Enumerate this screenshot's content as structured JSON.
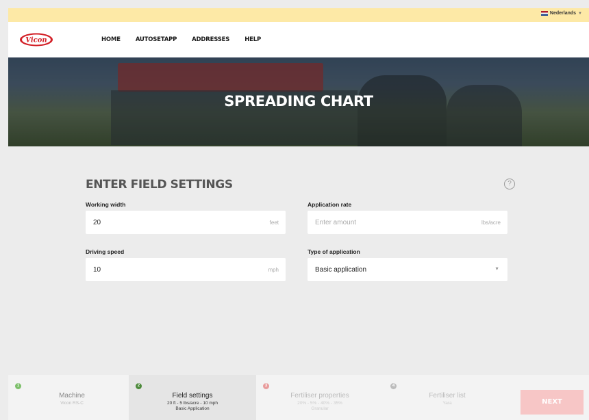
{
  "language": {
    "label": "Nederlands",
    "flag_icon": "netherlands-flag-icon"
  },
  "logo": {
    "text": "Vicon",
    "color": "#d32027"
  },
  "nav": {
    "items": [
      "HOME",
      "AUTOSETAPP",
      "ADDRESSES",
      "HELP"
    ]
  },
  "hero": {
    "title": "SPREADING CHART"
  },
  "form": {
    "title": "ENTER FIELD SETTINGS",
    "help_icon": "?",
    "working_width": {
      "label": "Working width",
      "value": "20",
      "unit": "feet"
    },
    "application_rate": {
      "label": "Application rate",
      "placeholder": "Enter amount",
      "unit": "lbs/acre"
    },
    "driving_speed": {
      "label": "Driving speed",
      "value": "10",
      "unit": "mph"
    },
    "application_type": {
      "label": "Type of application",
      "value": "Basic application"
    }
  },
  "steps": [
    {
      "number": "1",
      "name": "Machine",
      "sub": [
        "Vicon RS-C"
      ],
      "color": "#7cbf6a"
    },
    {
      "number": "2",
      "name": "Field settings",
      "sub": [
        "20 ft - 5 lbs/acre - 10 mph",
        "Basic Application"
      ],
      "color": "#4c8a3a"
    },
    {
      "number": "3",
      "name": "Fertiliser properties",
      "sub": [
        "20% - 5% - 40% - 35%",
        "Granular"
      ],
      "color": "#e89c9c"
    },
    {
      "number": "4",
      "name": "Fertiliser list",
      "sub": [
        "Yara"
      ],
      "color": "#bcbcbc"
    }
  ],
  "next_button": {
    "label": "NEXT"
  },
  "colors": {
    "top_bar": "#fde9a6",
    "next_button": "#f7c6c6",
    "panel": "#ececec"
  }
}
